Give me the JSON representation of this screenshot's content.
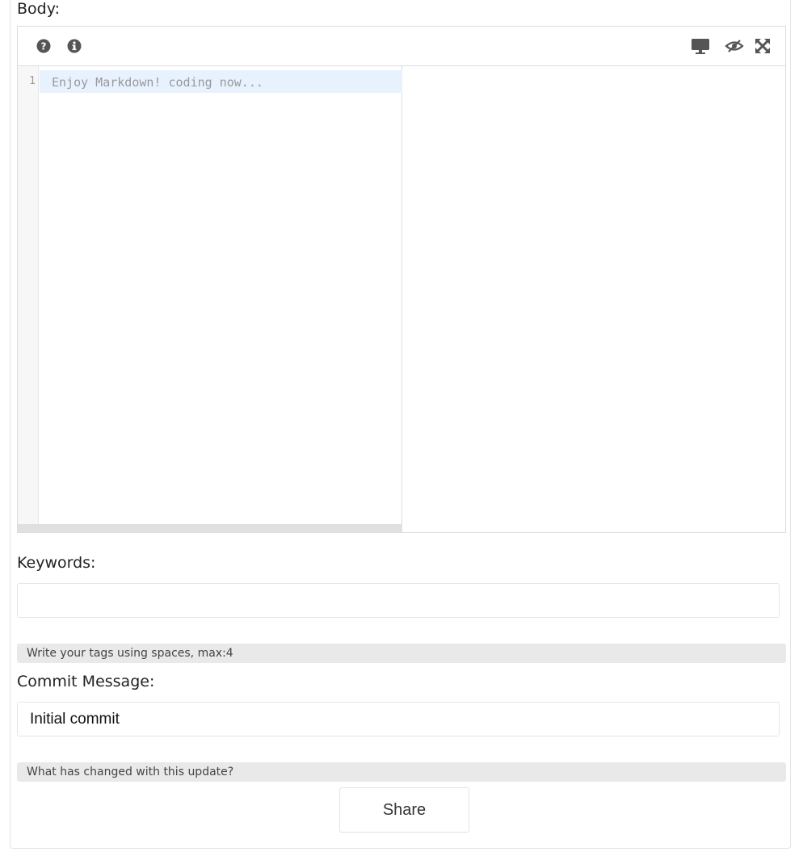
{
  "form": {
    "body_label": "Body:",
    "keywords_label": "Keywords:",
    "keywords_value": "",
    "keywords_help": "Write your tags using spaces, max:4",
    "commit_label": "Commit Message:",
    "commit_value": "Initial commit",
    "commit_help": "What has changed with this update?",
    "share_label": "Share"
  },
  "editor": {
    "line_number": "1",
    "placeholder": "Enjoy Markdown! coding now...",
    "toolbar_left": [
      "help-icon",
      "info-icon"
    ],
    "toolbar_right": [
      "desktop-preview-icon",
      "hide-preview-icon",
      "fullscreen-icon"
    ]
  },
  "colors": {
    "active_line": "#e8f2fe",
    "help_background": "#e9e9ea",
    "icon": "#555555"
  }
}
